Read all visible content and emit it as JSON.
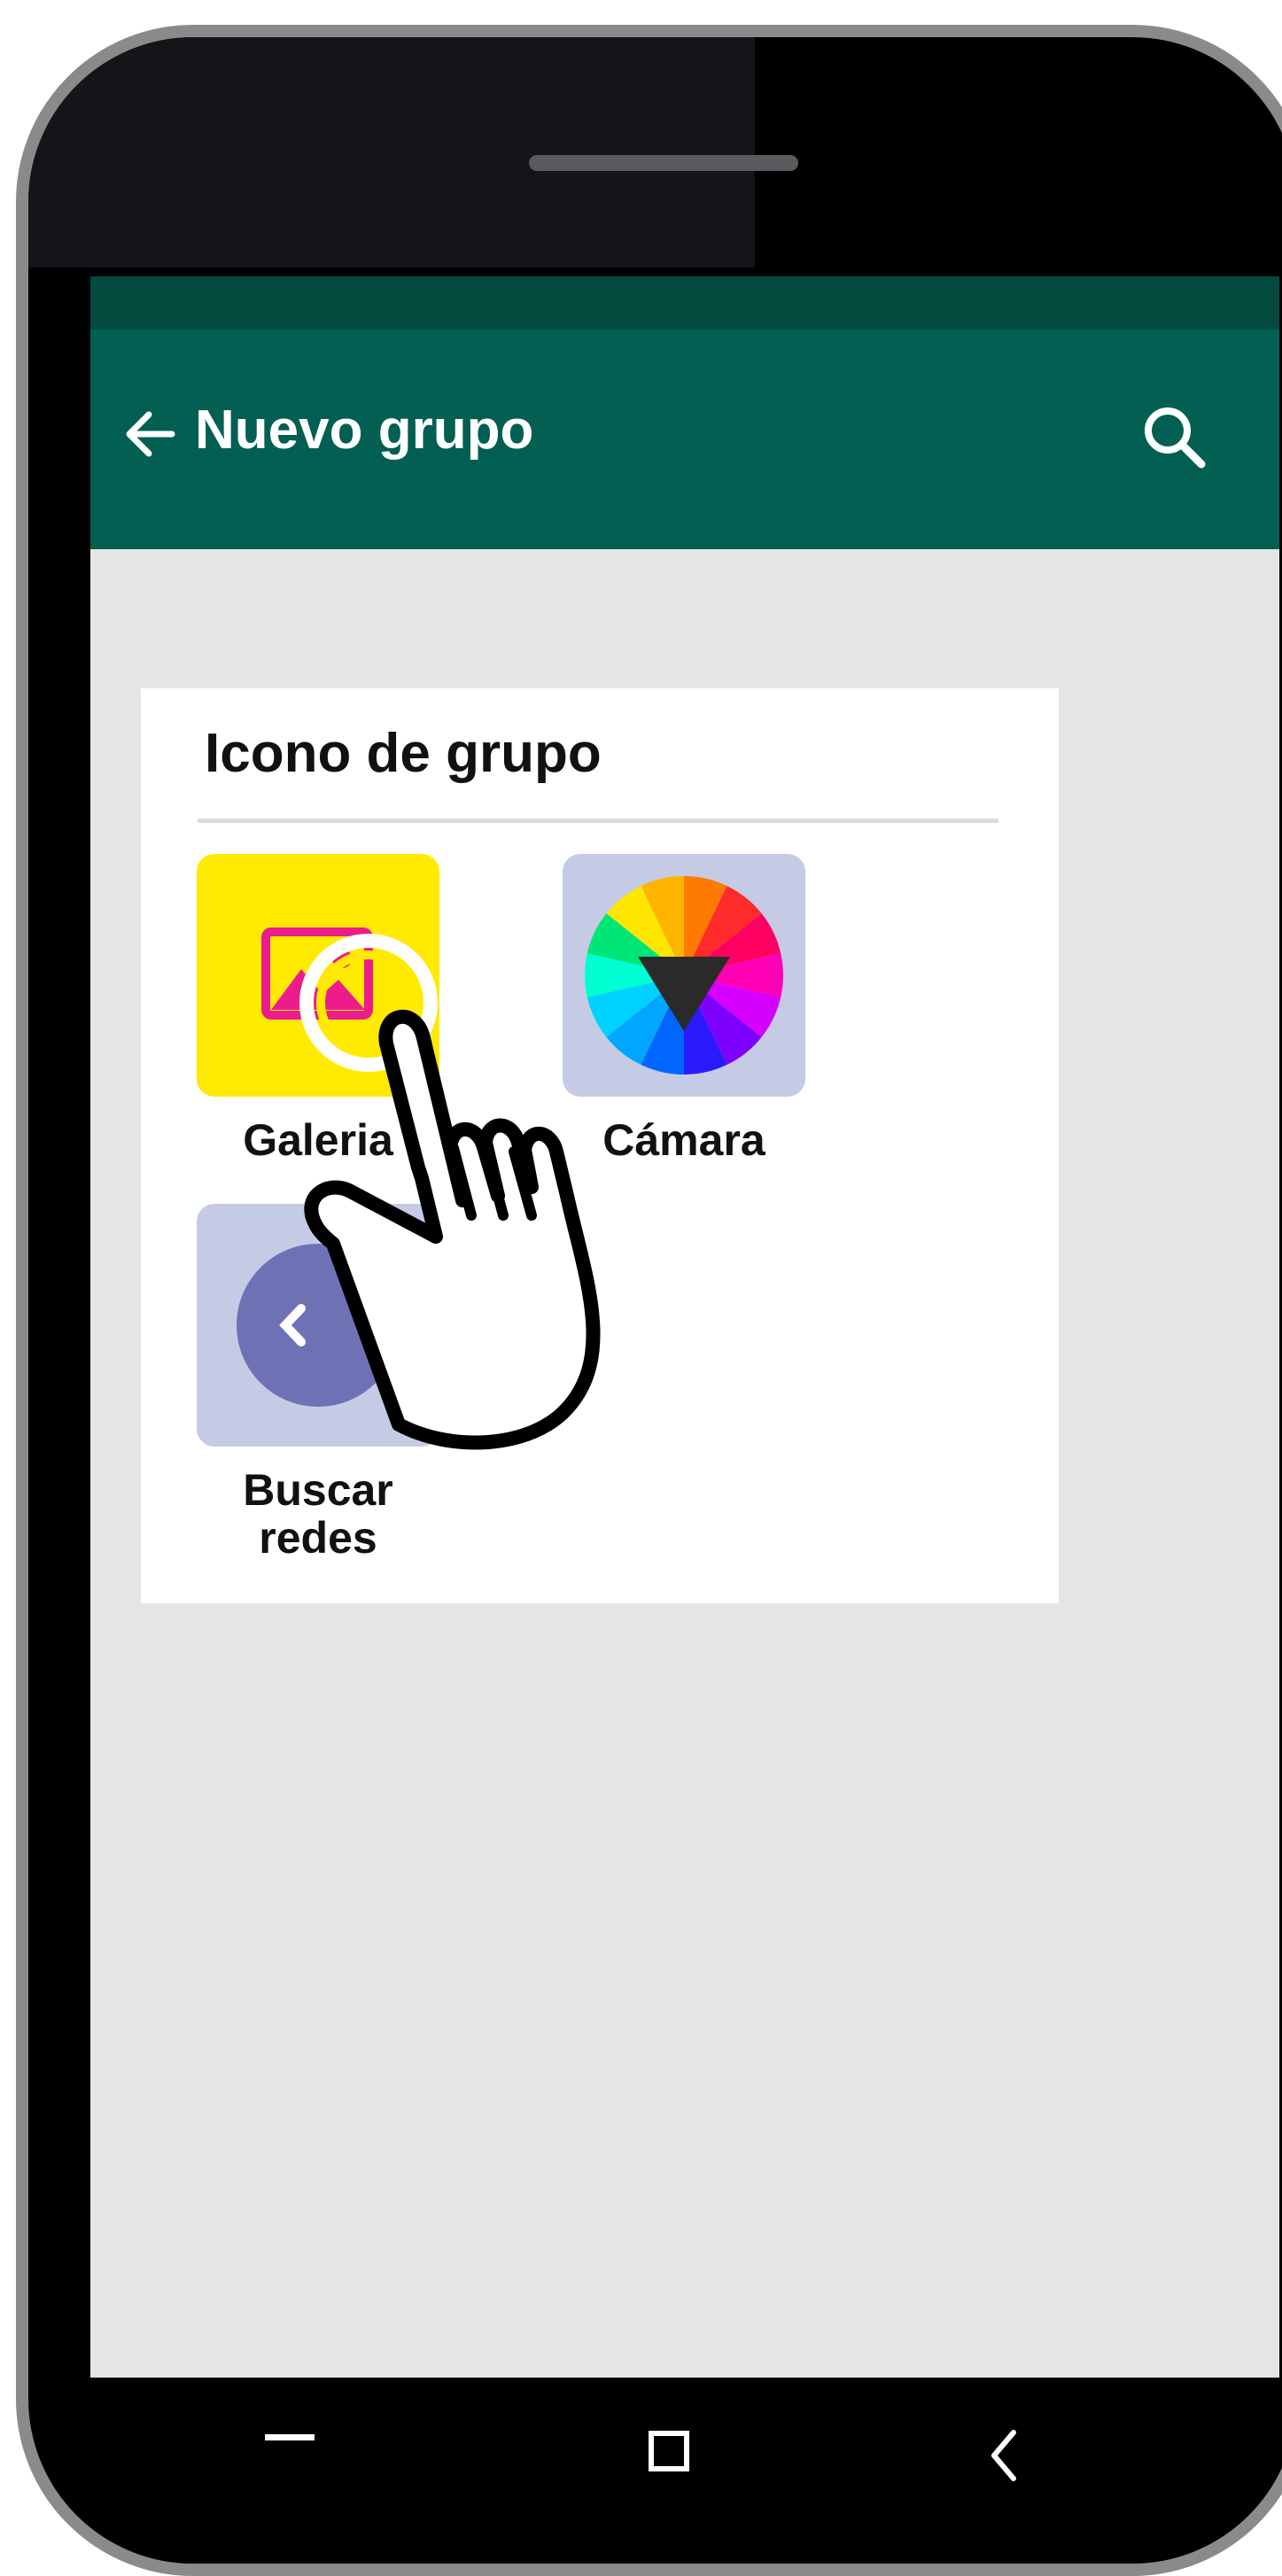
{
  "header": {
    "title": "Nuevo grupo",
    "back_icon": "arrow-left-icon",
    "search_icon": "search-icon"
  },
  "dialog": {
    "title": "Icono de grupo",
    "options": [
      {
        "label": "Galeria",
        "icon": "gallery-image-icon",
        "tile_color": "#ffea00"
      },
      {
        "label": "Cámara",
        "icon": "color-wheel-camera-icon",
        "tile_color": "#c5cbe5"
      },
      {
        "label": "Buscar redes",
        "icon": "search-web-icon",
        "tile_color": "#c5cbe5"
      }
    ]
  },
  "navbar": {
    "recent_icon": "recent-apps-icon",
    "home_icon": "home-square-icon",
    "back_icon": "back-chevron-icon"
  },
  "colors": {
    "app_bar": "#025f52",
    "status_bar": "#034b3f",
    "screen_background": "#e5e5e5",
    "gallery_pink": "#ec1c8c"
  }
}
